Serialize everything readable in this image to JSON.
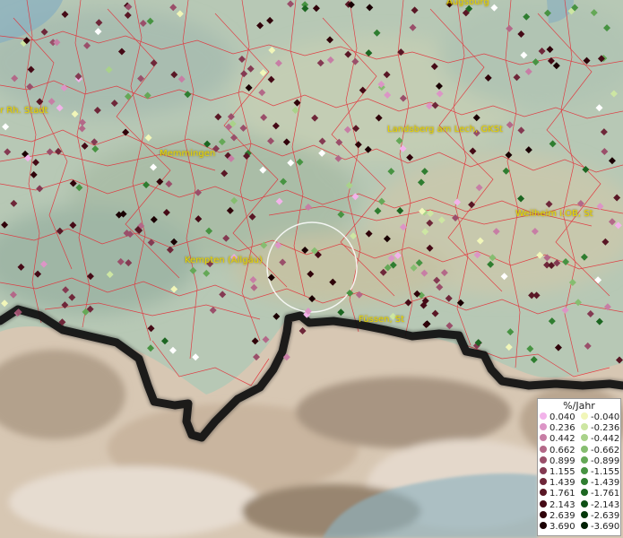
{
  "map": {
    "towns": [
      "Augsburg",
      "r Rh. Stadt",
      "Memmingen",
      "Landsberg am Lech, GKSt",
      "Weilheim i.OB, St",
      "Kempten (Allgäu)",
      "Füssen, St"
    ]
  },
  "legend": {
    "title": "%/Jahr",
    "positive": [
      {
        "label": "0.040",
        "color": "#f2b3ea"
      },
      {
        "label": "0.236",
        "color": "#dc95c6"
      },
      {
        "label": "0.442",
        "color": "#c77ea5"
      },
      {
        "label": "0.662",
        "color": "#b36888"
      },
      {
        "label": "0.899",
        "color": "#9a4f6a"
      },
      {
        "label": "1.155",
        "color": "#843a52"
      },
      {
        "label": "1.439",
        "color": "#6e2739"
      },
      {
        "label": "1.761",
        "color": "#591725"
      },
      {
        "label": "2.143",
        "color": "#450a16"
      },
      {
        "label": "2.639",
        "color": "#30030a"
      },
      {
        "label": "3.690",
        "color": "#1a0003"
      }
    ],
    "negative": [
      {
        "label": "-0.040",
        "color": "#f1f6b9"
      },
      {
        "label": "-0.236",
        "color": "#cde6a3"
      },
      {
        "label": "-0.442",
        "color": "#a9d28a"
      },
      {
        "label": "-0.662",
        "color": "#86bd70"
      },
      {
        "label": "-0.899",
        "color": "#65a857"
      },
      {
        "label": "-1.155",
        "color": "#479342"
      },
      {
        "label": "-1.439",
        "color": "#2f7d30"
      },
      {
        "label": "-1.761",
        "color": "#1c6621"
      },
      {
        "label": "-2.143",
        "color": "#0d4f14"
      },
      {
        "label": "-2.639",
        "color": "#04380a"
      },
      {
        "label": "-3.690",
        "color": "#002004"
      }
    ]
  }
}
